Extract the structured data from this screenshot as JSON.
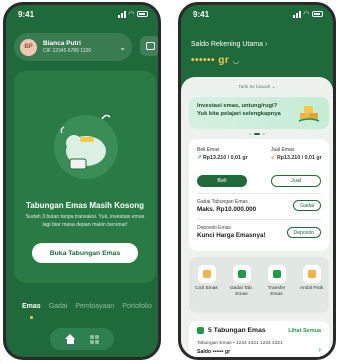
{
  "status": {
    "time": "9:41"
  },
  "left": {
    "account": {
      "avatar": "BP",
      "name": "Bianca Putri",
      "cif": "CIF 12345 6789 1100"
    },
    "empty": {
      "title": "Tabungan Emas Masih Kosong",
      "desc": "Sudah 3 bulan tanpa transaksi. Yuk, investasi emas lagi biar masa depan makin bersinar!",
      "cta": "Buka Tabungan Emas"
    },
    "tabs": [
      "Emas",
      "Gadai",
      "Pembiayaan",
      "Portofolio"
    ]
  },
  "right": {
    "saldo_label": "Saldo Rekening Utama",
    "saldo_value": "•••••• gr",
    "pull_hint": "Tarik ke bawah",
    "promo": "Investasi emas, untung/rugi? Yuk kita pelajari selengkapnya",
    "beli": {
      "label": "Beli Emas",
      "price": "Rp13.210 / 0,01 gr",
      "button": "Beli"
    },
    "jual": {
      "label": "Jual Emas",
      "price": "Rp13.210 / 0,01 gr",
      "button": "Jual"
    },
    "gadai": {
      "label": "Gadai Tabungan Emas",
      "value": "Maks. Rp10.000.000",
      "button": "Gadai"
    },
    "deposito": {
      "label": "Deposito Emas",
      "value": "Kunci Harga Emasnya!",
      "button": "Deposito"
    },
    "actions": [
      {
        "label": "Cicil Emas",
        "color": "#f3b24a"
      },
      {
        "label": "Gadai Tab. Emas",
        "color": "#1f9a4a"
      },
      {
        "label": "Transfer Emas",
        "color": "#1f9a4a"
      },
      {
        "label": "Ambil Fisik",
        "color": "#f3b24a"
      }
    ],
    "list": {
      "title": "5 Tabungan Emas",
      "see_all": "Lihat Semua",
      "account": "Tabungan Emas • 1234 4321 1234 4321",
      "saldo": "Saldo •••••• gr"
    }
  }
}
